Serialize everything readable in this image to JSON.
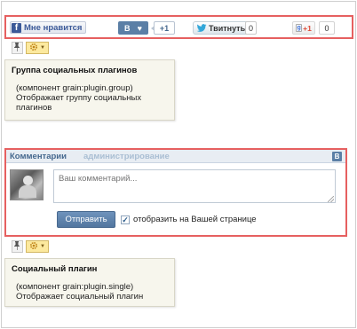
{
  "social_bar": {
    "facebook_label": "Мне нравится",
    "facebook_logo": "f",
    "vk_logo": "В",
    "vk_heart": "♥",
    "vk_count": "+1",
    "twitter_label": "Твитнуть",
    "twitter_count": "0",
    "google_label": "+1",
    "google_logo": "g",
    "google_count": "0"
  },
  "group_plugin": {
    "title": "Группа социальных плагинов",
    "description_line1": "(компонент grain:plugin.group)",
    "description_line2": "Отображает группу социальных",
    "description_line3": "плагинов"
  },
  "comments": {
    "tab_comments": "Комментарии",
    "tab_admin": "администрирование",
    "vk_badge": "В",
    "input_placeholder": "Ваш комментарий...",
    "submit_label": "Отправить",
    "checkbox_mark": "✓",
    "checkbox_label": "отобразить на Вашей странице"
  },
  "single_plugin": {
    "title": "Социальный плагин",
    "description_line1": "(компонент grain:plugin.single)",
    "description_line2": "Отображает социальный плагин"
  },
  "icons": {
    "pin": "pin-icon",
    "gear": "gear-icon",
    "twitter": "bird-icon"
  },
  "colors": {
    "highlight_border": "#e66060",
    "vk_blue": "#5b7fa6",
    "facebook_blue": "#3b5998",
    "google_red": "#dd4b39",
    "info_bg": "#f7f6ed"
  }
}
